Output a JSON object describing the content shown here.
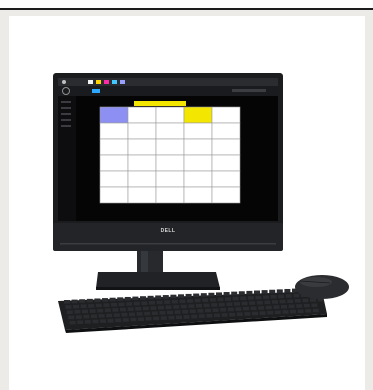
{
  "product": {
    "brand_logo_text": "DELL",
    "colors": {
      "page_background": "#ecebe8",
      "card_background": "#ffffff",
      "bezel": "#1b1c1e",
      "screen_background": "#050505",
      "app_chrome": "#2a2c30",
      "grid_cell": "#ffffff",
      "grid_line": "#9a9a9a",
      "highlight_cell_blue": "#8d8ff2",
      "highlight_cell_yellow": "#f3e600",
      "keyboard": "#1e1f21",
      "mouse": "#2b2c2f"
    }
  },
  "screen_app": {
    "grid": {
      "rows": 6,
      "columns": 5,
      "highlighted_cells": [
        {
          "row": 0,
          "column": 0,
          "color": "blue"
        },
        {
          "row": 0,
          "column": 3,
          "color": "yellow"
        }
      ]
    },
    "toolbar_icons": [
      "menu-icon",
      "home-icon",
      "tab-icon-1",
      "tab-icon-2",
      "tab-icon-3",
      "tab-icon-4",
      "tab-icon-5"
    ]
  }
}
